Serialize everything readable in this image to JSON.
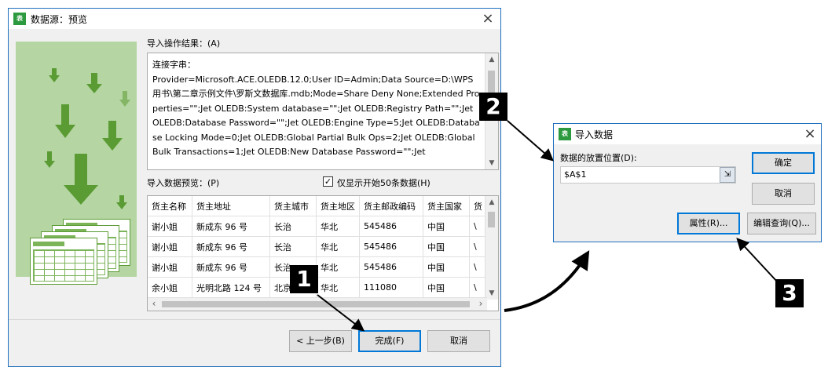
{
  "wizard": {
    "title": "数据源：预览",
    "result_label": "导入操作结果：(A)",
    "result_text": "连接字串：\nProvider=Microsoft.ACE.OLEDB.12.0;User ID=Admin;Data Source=D:\\WPS用书\\第二章示例文件\\罗斯文数据库.mdb;Mode=Share Deny None;Extended Properties=\"\";Jet OLEDB:System database=\"\";Jet OLEDB:Registry Path=\"\";Jet OLEDB:Database Password=\"\";Jet OLEDB:Engine Type=5;Jet OLEDB:Database Locking Mode=0;Jet OLEDB:Global Partial Bulk Ops=2;Jet OLEDB:Global Bulk Transactions=1;Jet OLEDB:New Database Password=\"\";Jet",
    "preview_label": "导入数据预览：(P)",
    "checkbox_label": "仅显示开始50条数据(H)",
    "checkbox_checked": "✓",
    "table": {
      "columns": [
        "货主名称",
        "货主地址",
        "货主城市",
        "货主地区",
        "货主邮政编码",
        "货主国家",
        "货"
      ],
      "rows": [
        [
          "谢小姐",
          "新成东 96 号",
          "长治",
          "华北",
          "545486",
          "中国",
          "\\"
        ],
        [
          "谢小姐",
          "新成东 96 号",
          "长治",
          "华北",
          "545486",
          "中国",
          "\\"
        ],
        [
          "谢小姐",
          "新成东 96 号",
          "长治",
          "华北",
          "545486",
          "中国",
          "\\"
        ],
        [
          "余小姐",
          "光明北路 124 号",
          "北京",
          "华北",
          "111080",
          "中国",
          "\\"
        ]
      ]
    },
    "buttons": {
      "prev": "< 上一步(B)",
      "finish": "完成(F)",
      "cancel": "取消"
    }
  },
  "import_dialog": {
    "title": "导入数据",
    "location_label": "数据的放置位置(D):",
    "location_value": "$A$1",
    "buttons": {
      "ok": "确定",
      "cancel": "取消",
      "properties": "属性(R)...",
      "edit_query": "编辑查询(Q)..."
    }
  },
  "callouts": {
    "one": "1",
    "two": "2",
    "three": "3"
  },
  "icons": {
    "app": "spreadsheet-app-icon",
    "close": "×"
  },
  "colors": {
    "accent": "#0078d7",
    "title_border": "#1e6fbe",
    "illustration_bg": "#b5d6a3",
    "illustration_fg": "#5a9b33",
    "app_icon": "#2e9a3f"
  }
}
